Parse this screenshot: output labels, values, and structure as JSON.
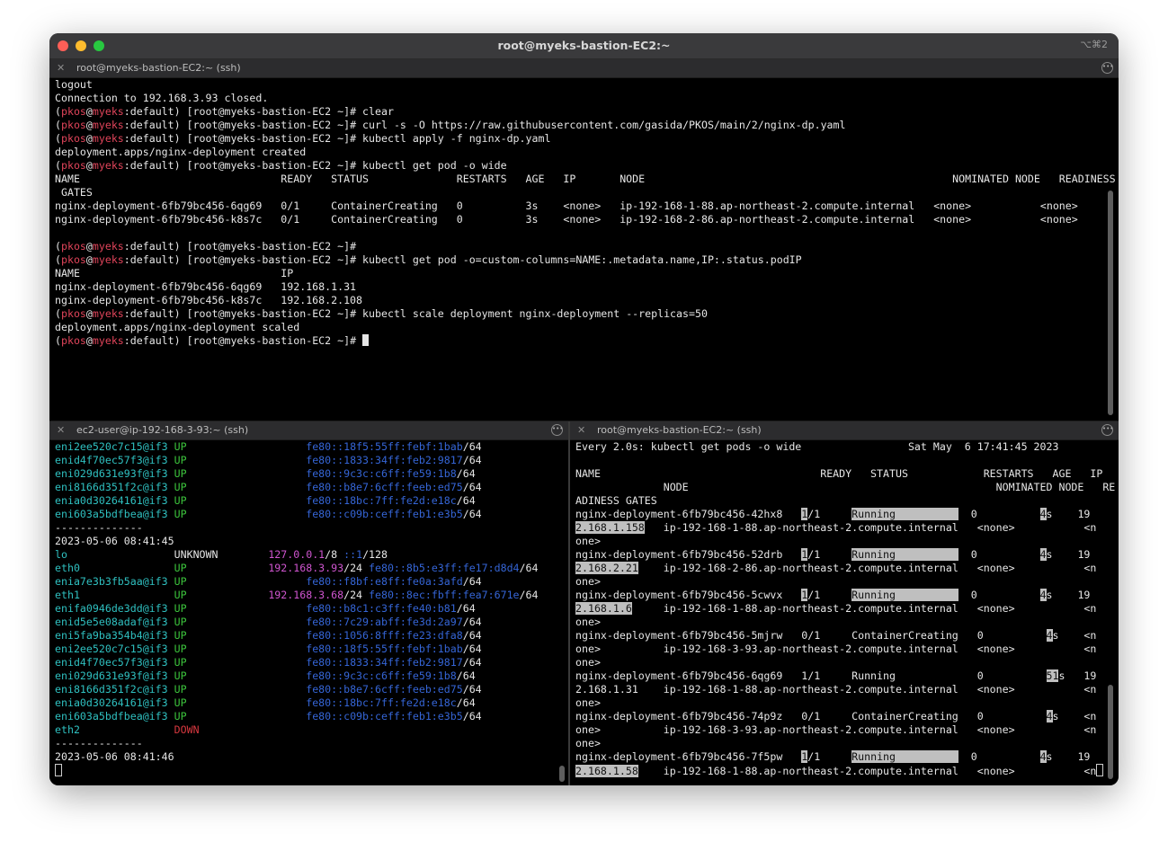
{
  "window": {
    "title": "root@myeks-bastion-EC2:~",
    "shortcut": "⌥⌘2"
  },
  "top_pane": {
    "tab_title": "root@myeks-bastion-EC2:~ (ssh)",
    "lines": [
      [
        [
          "logout",
          "white"
        ]
      ],
      [
        [
          "Connection to 192.168.3.93 closed.",
          "white"
        ]
      ],
      [
        [
          "(",
          "white"
        ],
        [
          "pkos",
          "red"
        ],
        [
          "@",
          "white"
        ],
        [
          "myeks",
          "red"
        ],
        [
          ":default) [root@myeks-bastion-EC2 ~]# clear",
          "white"
        ]
      ],
      [
        [
          "(",
          "white"
        ],
        [
          "pkos",
          "red"
        ],
        [
          "@",
          "white"
        ],
        [
          "myeks",
          "red"
        ],
        [
          ":default) [root@myeks-bastion-EC2 ~]# curl -s -O https://raw.githubusercontent.com/gasida/PKOS/main/2/nginx-dp.yaml",
          "white"
        ]
      ],
      [
        [
          "(",
          "white"
        ],
        [
          "pkos",
          "red"
        ],
        [
          "@",
          "white"
        ],
        [
          "myeks",
          "red"
        ],
        [
          ":default) [root@myeks-bastion-EC2 ~]# kubectl apply -f nginx-dp.yaml",
          "white"
        ]
      ],
      [
        [
          "deployment.apps/nginx-deployment created",
          "white"
        ]
      ],
      [
        [
          "(",
          "white"
        ],
        [
          "pkos",
          "red"
        ],
        [
          "@",
          "white"
        ],
        [
          "myeks",
          "red"
        ],
        [
          ":default) [root@myeks-bastion-EC2 ~]# kubectl get pod -o wide",
          "white"
        ]
      ],
      [
        [
          "NAME                                READY   STATUS              RESTARTS   AGE   IP       NODE                                                 NOMINATED NODE   READINESS",
          "white"
        ]
      ],
      [
        [
          " GATES",
          "white"
        ]
      ],
      [
        [
          "nginx-deployment-6fb79bc456-6qg69   0/1     ContainerCreating   0          3s    <none>   ip-192-168-1-88.ap-northeast-2.compute.internal   <none>           <none>",
          "white"
        ]
      ],
      [
        [
          "nginx-deployment-6fb79bc456-k8s7c   0/1     ContainerCreating   0          3s    <none>   ip-192-168-2-86.ap-northeast-2.compute.internal   <none>           <none>",
          "white"
        ]
      ],
      [],
      [
        [
          "(",
          "white"
        ],
        [
          "pkos",
          "red"
        ],
        [
          "@",
          "white"
        ],
        [
          "myeks",
          "red"
        ],
        [
          ":default) [root@myeks-bastion-EC2 ~]#",
          "white"
        ]
      ],
      [
        [
          "(",
          "white"
        ],
        [
          "pkos",
          "red"
        ],
        [
          "@",
          "white"
        ],
        [
          "myeks",
          "red"
        ],
        [
          ":default) [root@myeks-bastion-EC2 ~]# kubectl get pod -o=custom-columns=NAME:.metadata.name,IP:.status.podIP",
          "white"
        ]
      ],
      [
        [
          "NAME                                IP",
          "white"
        ]
      ],
      [
        [
          "nginx-deployment-6fb79bc456-6qg69   192.168.1.31",
          "white"
        ]
      ],
      [
        [
          "nginx-deployment-6fb79bc456-k8s7c   192.168.2.108",
          "white"
        ]
      ],
      [
        [
          "(",
          "white"
        ],
        [
          "pkos",
          "red"
        ],
        [
          "@",
          "white"
        ],
        [
          "myeks",
          "red"
        ],
        [
          ":default) [root@myeks-bastion-EC2 ~]# kubectl scale deployment nginx-deployment --replicas=50",
          "white"
        ]
      ],
      [
        [
          "deployment.apps/nginx-deployment scaled",
          "white"
        ]
      ],
      [
        [
          "(",
          "white"
        ],
        [
          "pkos",
          "red"
        ],
        [
          "@",
          "white"
        ],
        [
          "myeks",
          "red"
        ],
        [
          ":default) [root@myeks-bastion-EC2 ~]# ",
          "white"
        ],
        [
          "",
          "cursor"
        ]
      ]
    ]
  },
  "left_pane": {
    "tab_title": "ec2-user@ip-192-168-3-93:~ (ssh)",
    "lines": [
      [
        [
          "eni2ee520c7c15@if3 ",
          "cyan"
        ],
        [
          "UP             ",
          "green"
        ],
        [
          "      fe80::18f5:55ff:febf:1bab",
          "blue"
        ],
        [
          "/64",
          "white"
        ]
      ],
      [
        [
          "enid4f70ec57f3@if3 ",
          "cyan"
        ],
        [
          "UP             ",
          "green"
        ],
        [
          "      fe80::1833:34ff:feb2:9817",
          "blue"
        ],
        [
          "/64",
          "white"
        ]
      ],
      [
        [
          "eni029d631e93f@if3 ",
          "cyan"
        ],
        [
          "UP             ",
          "green"
        ],
        [
          "      fe80::9c3c:c6ff:fe59:1b8",
          "blue"
        ],
        [
          "/64",
          "white"
        ]
      ],
      [
        [
          "eni8166d351f2c@if3 ",
          "cyan"
        ],
        [
          "UP             ",
          "green"
        ],
        [
          "      fe80::b8e7:6cff:feeb:ed75",
          "blue"
        ],
        [
          "/64",
          "white"
        ]
      ],
      [
        [
          "enia0d30264161@if3 ",
          "cyan"
        ],
        [
          "UP             ",
          "green"
        ],
        [
          "      fe80::18bc:7ff:fe2d:e18c",
          "blue"
        ],
        [
          "/64",
          "white"
        ]
      ],
      [
        [
          "eni603a5bdfbea@if3 ",
          "cyan"
        ],
        [
          "UP             ",
          "green"
        ],
        [
          "      fe80::c09b:ceff:feb1:e3b5",
          "blue"
        ],
        [
          "/64",
          "white"
        ]
      ],
      [
        [
          "--------------",
          "white"
        ]
      ],
      [
        [
          "2023-05-06 08:41:45",
          "white"
        ]
      ],
      [
        [
          "lo                 ",
          "cyan"
        ],
        [
          "UNKNOWN        ",
          "white"
        ],
        [
          "127.0.0.1",
          "mag"
        ],
        [
          "/8 ",
          "white"
        ],
        [
          "::1",
          "blue"
        ],
        [
          "/128",
          "white"
        ]
      ],
      [
        [
          "eth0               ",
          "cyan"
        ],
        [
          "UP             ",
          "green"
        ],
        [
          "192.168.3.93",
          "mag"
        ],
        [
          "/24 ",
          "white"
        ],
        [
          "fe80::8b5:e3ff:fe17:d8d4",
          "blue"
        ],
        [
          "/64",
          "white"
        ]
      ],
      [
        [
          "enia7e3b3fb5aa@if3 ",
          "cyan"
        ],
        [
          "UP             ",
          "green"
        ],
        [
          "      fe80::f8bf:e8ff:fe0a:3afd",
          "blue"
        ],
        [
          "/64",
          "white"
        ]
      ],
      [
        [
          "eth1               ",
          "cyan"
        ],
        [
          "UP             ",
          "green"
        ],
        [
          "192.168.3.68",
          "mag"
        ],
        [
          "/24 ",
          "white"
        ],
        [
          "fe80::8ec:fbff:fea7:671e",
          "blue"
        ],
        [
          "/64",
          "white"
        ]
      ],
      [
        [
          "enifa0946de3dd@if3 ",
          "cyan"
        ],
        [
          "UP             ",
          "green"
        ],
        [
          "      fe80::b8c1:c3ff:fe40:b81",
          "blue"
        ],
        [
          "/64",
          "white"
        ]
      ],
      [
        [
          "enid5e5e08adaf@if3 ",
          "cyan"
        ],
        [
          "UP             ",
          "green"
        ],
        [
          "      fe80::7c29:abff:fe3d:2a97",
          "blue"
        ],
        [
          "/64",
          "white"
        ]
      ],
      [
        [
          "eni5fa9ba354b4@if3 ",
          "cyan"
        ],
        [
          "UP             ",
          "green"
        ],
        [
          "      fe80::1056:8fff:fe23:dfa8",
          "blue"
        ],
        [
          "/64",
          "white"
        ]
      ],
      [
        [
          "eni2ee520c7c15@if3 ",
          "cyan"
        ],
        [
          "UP             ",
          "green"
        ],
        [
          "      fe80::18f5:55ff:febf:1bab",
          "blue"
        ],
        [
          "/64",
          "white"
        ]
      ],
      [
        [
          "enid4f70ec57f3@if3 ",
          "cyan"
        ],
        [
          "UP             ",
          "green"
        ],
        [
          "      fe80::1833:34ff:feb2:9817",
          "blue"
        ],
        [
          "/64",
          "white"
        ]
      ],
      [
        [
          "eni029d631e93f@if3 ",
          "cyan"
        ],
        [
          "UP             ",
          "green"
        ],
        [
          "      fe80::9c3c:c6ff:fe59:1b8",
          "blue"
        ],
        [
          "/64",
          "white"
        ]
      ],
      [
        [
          "eni8166d351f2c@if3 ",
          "cyan"
        ],
        [
          "UP             ",
          "green"
        ],
        [
          "      fe80::b8e7:6cff:feeb:ed75",
          "blue"
        ],
        [
          "/64",
          "white"
        ]
      ],
      [
        [
          "enia0d30264161@if3 ",
          "cyan"
        ],
        [
          "UP             ",
          "green"
        ],
        [
          "      fe80::18bc:7ff:fe2d:e18c",
          "blue"
        ],
        [
          "/64",
          "white"
        ]
      ],
      [
        [
          "eni603a5bdfbea@if3 ",
          "cyan"
        ],
        [
          "UP             ",
          "green"
        ],
        [
          "      fe80::c09b:ceff:feb1:e3b5",
          "blue"
        ],
        [
          "/64",
          "white"
        ]
      ],
      [
        [
          "eth2               ",
          "cyan"
        ],
        [
          "DOWN",
          "dred"
        ]
      ],
      [
        [
          "--------------",
          "white"
        ]
      ],
      [
        [
          "2023-05-06 08:41:46",
          "white"
        ]
      ],
      [
        [
          "",
          "hollow"
        ]
      ]
    ]
  },
  "right_pane": {
    "tab_title": "root@myeks-bastion-EC2:~ (ssh)",
    "lines": [
      [
        [
          "Every 2.0s: kubectl get pods -o wide                 Sat May  6 17:41:45 2023",
          "white"
        ]
      ],
      [],
      [
        [
          "NAME                                   READY   STATUS            RESTARTS   AGE   IP",
          "white"
        ]
      ],
      [
        [
          "              NODE                                                 NOMINATED NODE   RE",
          "white"
        ]
      ],
      [
        [
          "ADINESS GATES",
          "white"
        ]
      ],
      [
        [
          "nginx-deployment-6fb79bc456-42hx8   ",
          "white"
        ],
        [
          "1",
          "hl"
        ],
        [
          "/1     ",
          "white"
        ],
        [
          "Ru",
          "hl"
        ],
        [
          "nning          ",
          "hl"
        ],
        [
          "  0          ",
          "white"
        ],
        [
          "4",
          "hl"
        ],
        [
          "s    ",
          "white"
        ],
        [
          "19",
          "white"
        ]
      ],
      [
        [
          "2.168.1.158",
          "hl"
        ],
        [
          "   ip-192-168-1-88.ap-northeast-2.compute.internal   <none>           <n",
          "white"
        ]
      ],
      [
        [
          "one>",
          "white"
        ]
      ],
      [
        [
          "nginx-deployment-6fb79bc456-52drb   ",
          "white"
        ],
        [
          "1",
          "hl"
        ],
        [
          "/1     ",
          "white"
        ],
        [
          "Ru",
          "hl"
        ],
        [
          "nning          ",
          "hl"
        ],
        [
          "  0          ",
          "white"
        ],
        [
          "4",
          "hl"
        ],
        [
          "s    ",
          "white"
        ],
        [
          "19",
          "white"
        ]
      ],
      [
        [
          "2.168.2.21",
          "hl"
        ],
        [
          "    ip-192-168-2-86.ap-northeast-2.compute.internal   <none>           <n",
          "white"
        ]
      ],
      [
        [
          "one>",
          "white"
        ]
      ],
      [
        [
          "nginx-deployment-6fb79bc456-5cwvx   ",
          "white"
        ],
        [
          "1",
          "hl"
        ],
        [
          "/1     ",
          "white"
        ],
        [
          "Ru",
          "hl"
        ],
        [
          "nning          ",
          "hl"
        ],
        [
          "  0          ",
          "white"
        ],
        [
          "4",
          "hl"
        ],
        [
          "s    ",
          "white"
        ],
        [
          "19",
          "white"
        ]
      ],
      [
        [
          "2.168.1.6",
          "hl"
        ],
        [
          "     ip-192-168-1-88.ap-northeast-2.compute.internal   <none>           <n",
          "white"
        ]
      ],
      [
        [
          "one>",
          "white"
        ]
      ],
      [
        [
          "nginx-deployment-6fb79bc456-5mjrw   0/1     ContainerCreating   0          ",
          "white"
        ],
        [
          "4",
          "hl"
        ],
        [
          "s    <n",
          "white"
        ]
      ],
      [
        [
          "one>          ip-192-168-3-93.ap-northeast-2.compute.internal   <none>           <n",
          "white"
        ]
      ],
      [
        [
          "one>",
          "white"
        ]
      ],
      [
        [
          "nginx-deployment-6fb79bc456-6qg69   1/1     Running             0          ",
          "white"
        ],
        [
          "51",
          "hl"
        ],
        [
          "s   19",
          "white"
        ]
      ],
      [
        [
          "2.168.1.31    ip-192-168-1-88.ap-northeast-2.compute.internal   <none>           <n",
          "white"
        ]
      ],
      [
        [
          "one>",
          "white"
        ]
      ],
      [
        [
          "nginx-deployment-6fb79bc456-74p9z   0/1     ContainerCreating   0          ",
          "white"
        ],
        [
          "4",
          "hl"
        ],
        [
          "s    <n",
          "white"
        ]
      ],
      [
        [
          "one>          ip-192-168-3-93.ap-northeast-2.compute.internal   <none>           <n",
          "white"
        ]
      ],
      [
        [
          "one>",
          "white"
        ]
      ],
      [
        [
          "nginx-deployment-6fb79bc456-7f5pw   ",
          "white"
        ],
        [
          "1",
          "hl"
        ],
        [
          "/1     ",
          "white"
        ],
        [
          "Ru",
          "hl"
        ],
        [
          "nning          ",
          "hl"
        ],
        [
          "  0          ",
          "white"
        ],
        [
          "4",
          "hl"
        ],
        [
          "s    ",
          "white"
        ],
        [
          "19",
          "white"
        ]
      ],
      [
        [
          "2.168.1.58",
          "hl"
        ],
        [
          "    ip-192-168-1-88.ap-northeast-2.compute.internal   <none>           <n",
          "white"
        ],
        [
          "",
          "hollow"
        ]
      ]
    ]
  }
}
